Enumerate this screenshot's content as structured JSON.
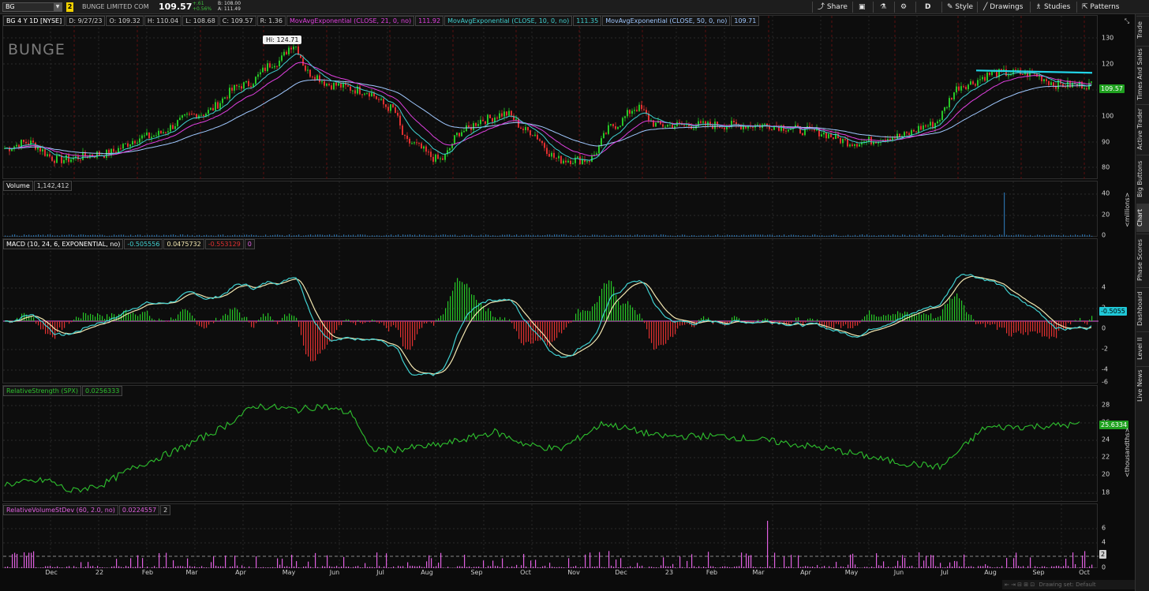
{
  "toolbar": {
    "symbol": "BG",
    "link_number": "2",
    "company": "BUNGE LIMITED COM",
    "last": "109.57",
    "change": "+.61",
    "change_pct": "+0.56%",
    "bid": "B: 108.00",
    "ask": "A: 111.49",
    "share": "Share",
    "aggregation": "D",
    "style": "Style",
    "drawings": "Drawings",
    "studies": "Studies",
    "patterns": "Patterns"
  },
  "price_panel": {
    "header": [
      "BG 4 Y 1D [NYSE]",
      "D: 9/27/23",
      "O: 109.32",
      "H: 110.04",
      "L: 108.68",
      "C: 109.57",
      "R: 1.36",
      "MovAvgExponential (CLOSE, 21, 0, no)",
      "111.92",
      "MovAvgExponential (CLOSE, 10, 0, no)",
      "111.35",
      "MovAvgExponential (CLOSE, 50, 0, no)",
      "109.71"
    ],
    "watermark": "BUNGE",
    "hi_label": "Hi: 124.71",
    "last_tag": "109.57",
    "ticks": [
      "130",
      "120",
      "110",
      "100",
      "90",
      "80"
    ],
    "ylim": [
      77,
      134
    ]
  },
  "volume_panel": {
    "header": [
      "Volume",
      "1,142,412"
    ],
    "ticks": [
      "40",
      "20",
      "0"
    ],
    "unit": "<millions>"
  },
  "macd_panel": {
    "header": [
      "MACD (10, 24, 6, EXPONENTIAL, no)",
      "-0.505556",
      "0.0475732",
      "-0.553129",
      "0"
    ],
    "ticks": [
      "4",
      "2",
      "0",
      "-2",
      "-4",
      "-6"
    ],
    "last_tag": "-0.5055"
  },
  "rs_panel": {
    "header": [
      "RelativeStrength (SPX)",
      "0.0256333"
    ],
    "ticks": [
      "28",
      "26",
      "24",
      "22",
      "20",
      "18"
    ],
    "unit": "<thousandths>",
    "last_tag": "25.6334"
  },
  "rvs_panel": {
    "header": [
      "RelativeVolumeStDev (60, 2.0, no)",
      "0.0224557",
      "2"
    ],
    "ticks": [
      "6",
      "4",
      "2",
      "0"
    ],
    "last_tag": "2"
  },
  "xaxis": [
    "Dec",
    "22",
    "Feb",
    "Mar",
    "Apr",
    "May",
    "Jun",
    "Jul",
    "Aug",
    "Sep",
    "Oct",
    "Nov",
    "Dec",
    "23",
    "Feb",
    "Mar",
    "Apr",
    "May",
    "Jun",
    "Jul",
    "Aug",
    "Sep",
    "Oct"
  ],
  "side_tabs": [
    "Trade",
    "Times And Sales",
    "Active Trader",
    "Big Buttons",
    "Chart",
    "Phase Scores",
    "Dashboard",
    "Level II",
    "Live News"
  ],
  "bottom_bar": "Drawing set: Default",
  "colors": {
    "ema21": "#e040e0",
    "ema10": "#40d0d0",
    "ema50": "#a0c8ff",
    "up": "#26c626",
    "down": "#e03030",
    "trendline": "#22d3e6",
    "rs": "#2ec02e",
    "rvs": "#e060e0"
  }
}
